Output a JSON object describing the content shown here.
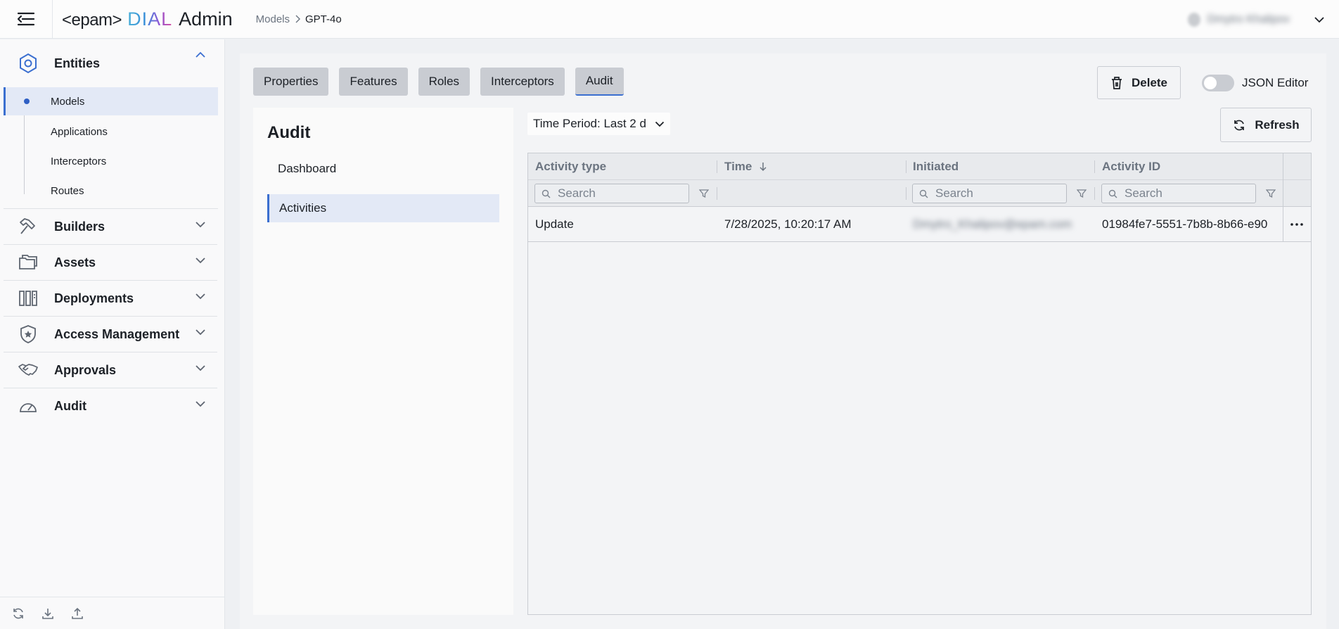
{
  "header": {
    "logo_epam": "<epam>",
    "logo_dial": "DIAL",
    "logo_admin": "Admin",
    "breadcrumb": [
      "Models",
      "GPT-4o"
    ],
    "user_name": "Dmytro Khalipov"
  },
  "sidebar": {
    "entities": {
      "label": "Entities",
      "items": [
        "Models",
        "Applications",
        "Interceptors",
        "Routes"
      ],
      "active_item": "Models"
    },
    "sections": [
      {
        "label": "Builders",
        "icon": "hammer-icon"
      },
      {
        "label": "Assets",
        "icon": "folders-icon"
      },
      {
        "label": "Deployments",
        "icon": "deployments-icon"
      },
      {
        "label": "Access Management",
        "icon": "shield-star-icon"
      },
      {
        "label": "Approvals",
        "icon": "handshake-icon"
      },
      {
        "label": "Audit",
        "icon": "gauge-icon"
      }
    ],
    "footer_icons": [
      "reload-icon",
      "download-icon",
      "upload-icon"
    ]
  },
  "toolbar": {
    "tabs": [
      "Properties",
      "Features",
      "Roles",
      "Interceptors",
      "Audit"
    ],
    "active_tab": "Audit",
    "delete_label": "Delete",
    "json_editor_label": "JSON Editor",
    "json_editor_on": false
  },
  "audit": {
    "title": "Audit",
    "nav": [
      "Dashboard",
      "Activities"
    ],
    "active_nav": "Activities",
    "time_period": "Time Period: Last 2 d",
    "refresh_label": "Refresh",
    "columns": [
      "Activity type",
      "Time",
      "Initiated",
      "Activity ID"
    ],
    "sort_column": "Time",
    "search_placeholder": "Search",
    "rows": [
      {
        "activity_type": "Update",
        "time": "7/28/2025, 10:20:17 AM",
        "initiated": "Dmytro_Khalipov@epam.com",
        "activity_id": "01984fe7-5551-7b8b-8b66-e90"
      }
    ]
  },
  "colors": {
    "accent": "#3b6fd0",
    "active_bg": "#e3e9f6",
    "tab_bg": "#c9ccd2"
  }
}
